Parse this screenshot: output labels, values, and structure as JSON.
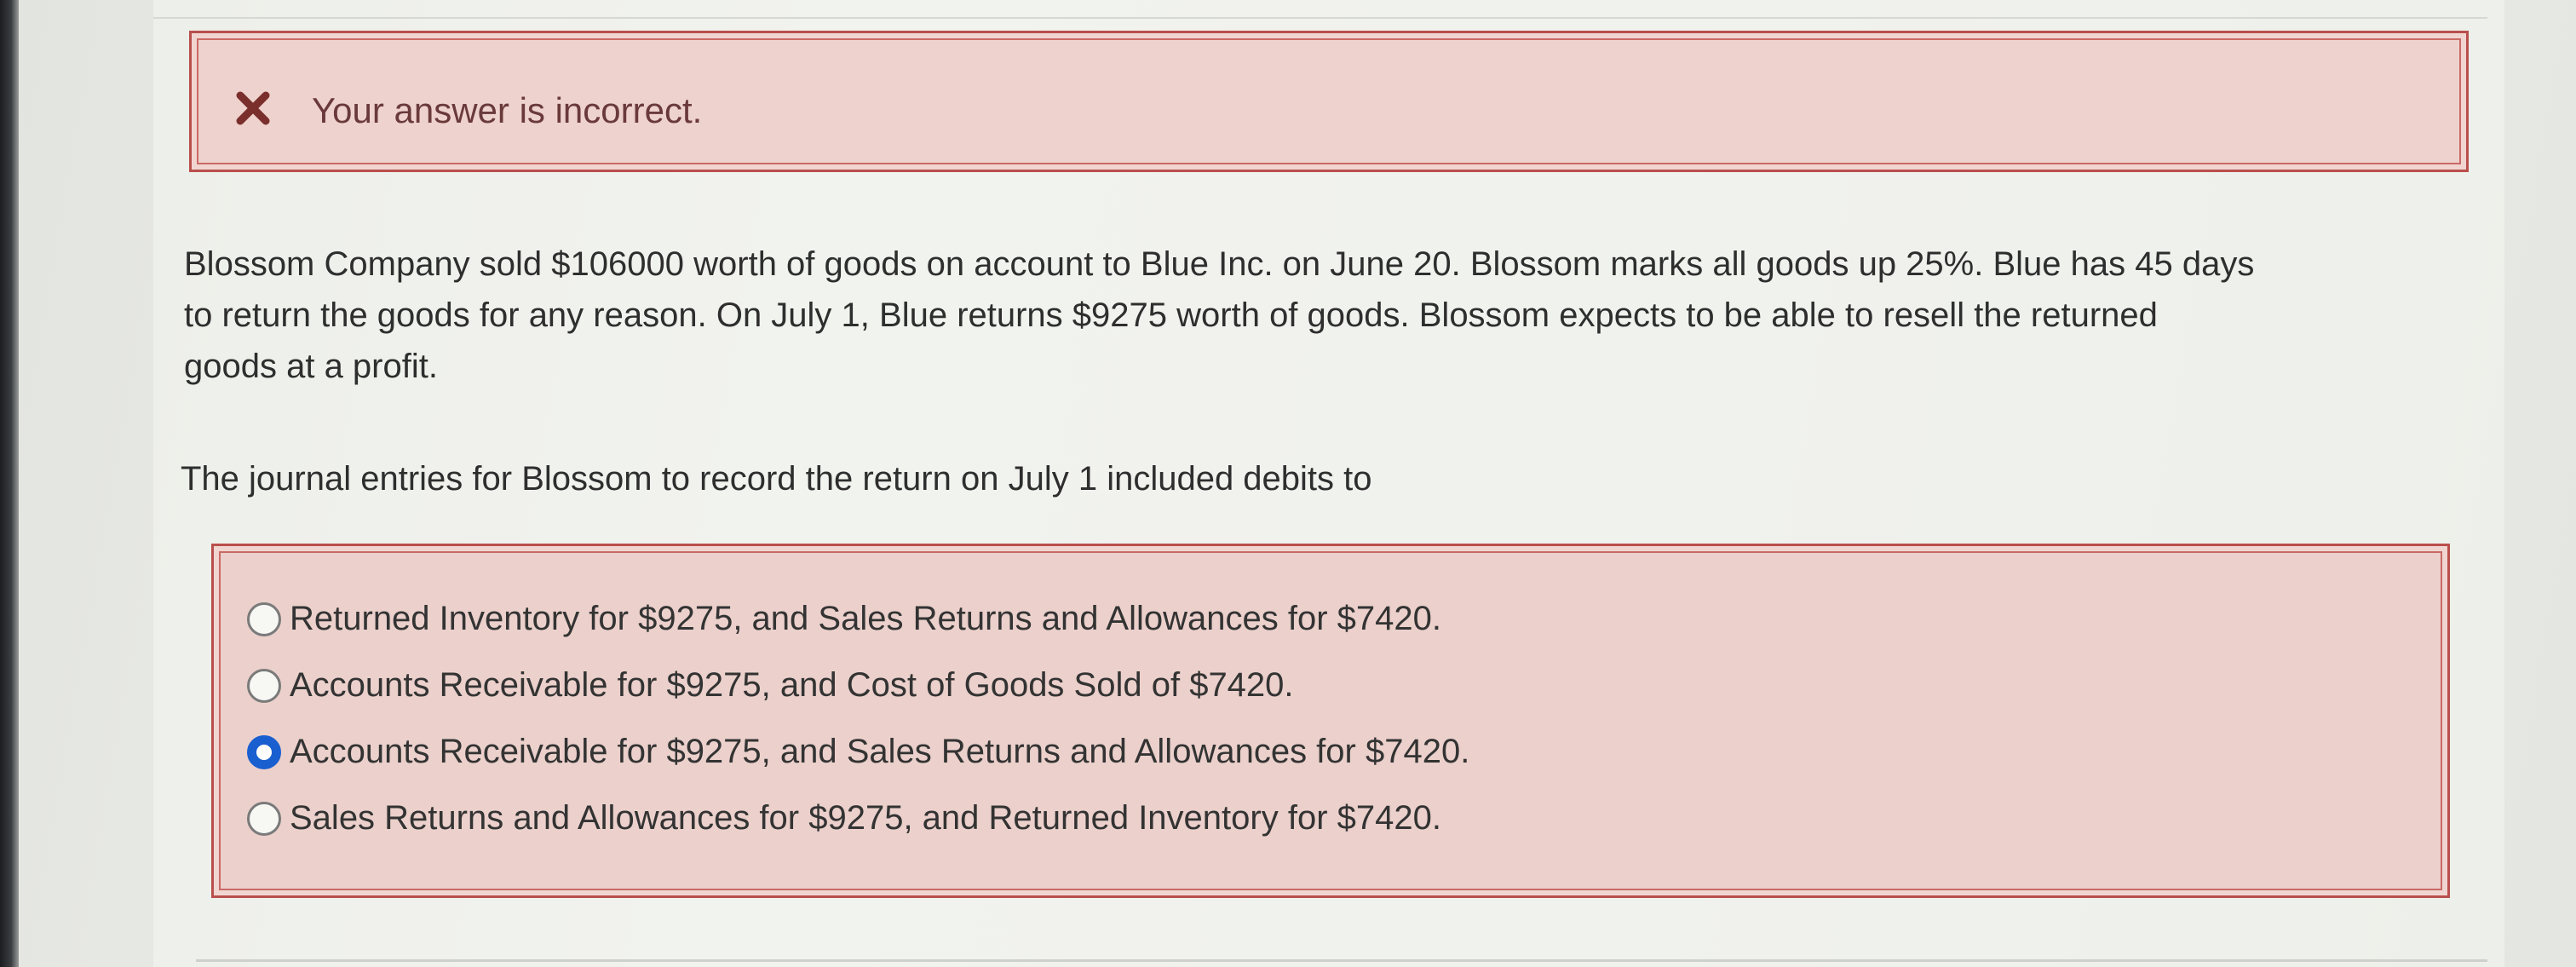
{
  "feedback": {
    "icon": "x-icon",
    "icon_color": "#7a2f2c",
    "message": "Your answer is incorrect."
  },
  "question": {
    "lines": [
      "Blossom Company sold $106000 worth of goods on account to Blue Inc. on June 20. Blossom marks all goods up 25%. Blue has 45 days",
      "to return the goods for any reason. On July 1, Blue returns $9275 worth of goods. Blossom expects to be able to resell the returned",
      "goods at a profit."
    ],
    "prompt": "The journal entries for Blossom to record the return on July 1 included debits to"
  },
  "options": [
    {
      "label": "Returned Inventory for $9275, and Sales Returns and Allowances for $7420.",
      "selected": false
    },
    {
      "label": "Accounts Receivable for $9275, and Cost of Goods Sold of $7420.",
      "selected": false
    },
    {
      "label": "Accounts Receivable for $9275, and Sales Returns and Allowances for $7420.",
      "selected": true
    },
    {
      "label": "Sales Returns and Allowances for $9275, and Returned Inventory for $7420.",
      "selected": false
    }
  ],
  "colors": {
    "error_border": "#b94f4c",
    "error_background": "#eed2cd",
    "radio_selected": "#1a5fd0"
  }
}
